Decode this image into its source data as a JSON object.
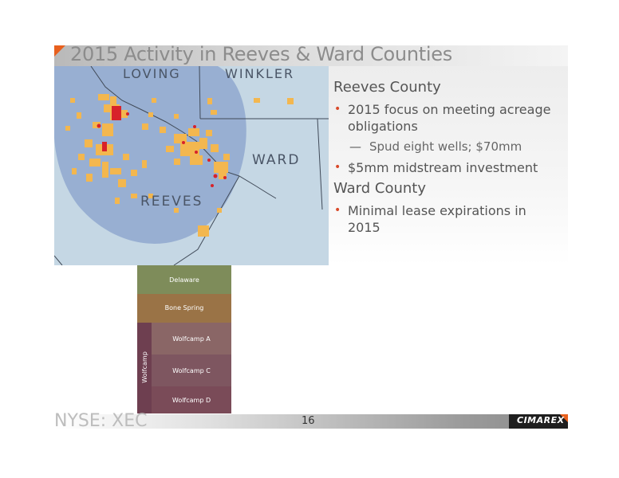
{
  "slide": {
    "title": "2015 Activity in Reeves & Ward Counties",
    "map": {
      "labels": {
        "loving": "LOVING",
        "winkler": "WINKLER",
        "ward": "WARD",
        "reeves": "REEVES"
      }
    },
    "sections": [
      {
        "heading": "Reeves County",
        "bullets": [
          {
            "text": "2015 focus on meeting acreage obligations"
          },
          {
            "text": "$5mm midstream investment"
          }
        ],
        "sub_bullet": "Spud eight wells; $70mm"
      },
      {
        "heading": "Ward County",
        "bullets": [
          {
            "text": "Minimal lease expirations in 2015"
          }
        ]
      }
    ],
    "stratigraphy": {
      "layers": [
        "Delaware",
        "Bone Spring",
        "Wolfcamp A",
        "Wolfcamp C",
        "Wolfcamp D"
      ],
      "group_label": "Wolfcamp"
    },
    "footer": {
      "ticker": "NYSE: XEC",
      "page_number": "16",
      "logo": "CIMAREX"
    },
    "colors": {
      "accent": "#e8601e",
      "bullet": "#d94a2a",
      "map_water": "#c5d7e4",
      "map_basin": "#8fa8cf",
      "acreage": "#f3b74f",
      "wells": "#d8222a"
    }
  }
}
